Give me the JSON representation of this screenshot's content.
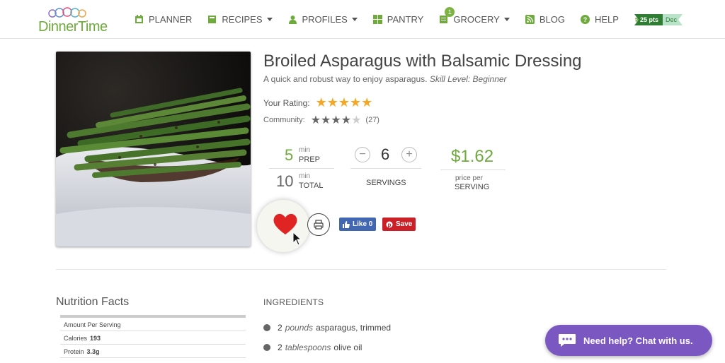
{
  "brand": {
    "name": "DinnerTime"
  },
  "nav": {
    "items": [
      {
        "label": "PLANNER",
        "icon": "calendar-icon",
        "caret": false
      },
      {
        "label": "RECIPES",
        "icon": "book-icon",
        "caret": true
      },
      {
        "label": "PROFILES",
        "icon": "person-icon",
        "caret": true
      },
      {
        "label": "PANTRY",
        "icon": "grid-icon",
        "caret": false
      },
      {
        "label": "GROCERY",
        "icon": "list-icon",
        "caret": true,
        "badge": "1"
      },
      {
        "label": "BLOG",
        "icon": "rss-icon",
        "caret": false
      },
      {
        "label": "HELP",
        "icon": "question-icon",
        "caret": false
      }
    ],
    "settings_icon": "gear-icon",
    "points": "25 pts",
    "month": "Dec"
  },
  "recipe": {
    "title": "Broiled Asparagus with Balsamic Dressing",
    "description": "A quick and robust way to enjoy asparagus.",
    "skill": "Skill Level: Beginner",
    "your_rating_label": "Your Rating:",
    "your_rating": 5,
    "community_label": "Community:",
    "community_rating": 4,
    "community_count": "(27)",
    "prep_value": "5",
    "prep_unit": "min",
    "prep_label": "PREP",
    "total_value": "10",
    "total_unit": "min",
    "total_label": "TOTAL",
    "servings_value": "6",
    "servings_label": "SERVINGS",
    "minus": "−",
    "plus": "+",
    "price": "$1.62",
    "price_label_1": "price per",
    "price_label_2": "SERVING"
  },
  "social": {
    "fb_label": "Like 0",
    "pin_label": "Save"
  },
  "nutrition": {
    "title": "Nutrition Facts",
    "rows": [
      {
        "label": "Amount Per Serving",
        "value": ""
      },
      {
        "label": "Calories",
        "value": "193"
      },
      {
        "label": "Protein",
        "value": "3.3g"
      }
    ]
  },
  "ingredients": {
    "title": "INGREDIENTS",
    "items": [
      {
        "qty": "2",
        "unit": "pounds",
        "name": "asparagus, trimmed"
      },
      {
        "qty": "2",
        "unit": "tablespoons",
        "name": "olive oil"
      }
    ]
  },
  "chat": {
    "label": "Need help? Chat with us."
  },
  "colors": {
    "brand_green": "#6eaa3c",
    "accent_purple": "#7b57c2",
    "star_gold": "#f5a623",
    "heart_red": "#e02424"
  }
}
